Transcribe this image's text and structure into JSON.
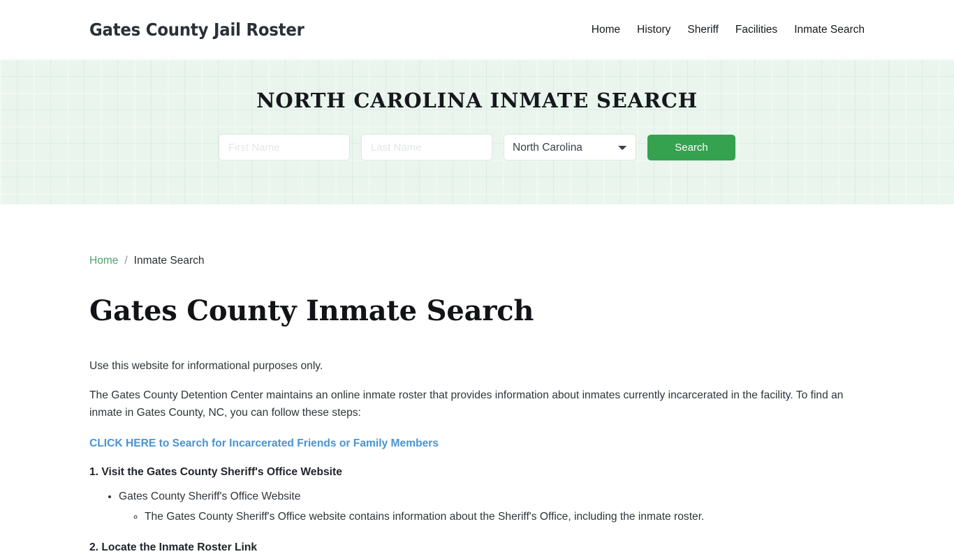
{
  "header": {
    "brand": "Gates County Jail Roster",
    "nav": [
      {
        "label": "Home"
      },
      {
        "label": "History"
      },
      {
        "label": "Sheriff"
      },
      {
        "label": "Facilities"
      },
      {
        "label": "Inmate Search"
      }
    ]
  },
  "hero": {
    "title": "NORTH CAROLINA INMATE SEARCH",
    "background_color": "#e9f5ed",
    "form": {
      "first_name_placeholder": "First Name",
      "first_name_value": "",
      "last_name_placeholder": "Last Name",
      "last_name_value": "",
      "state_selected": "North Carolina",
      "state_options": [
        "North Carolina"
      ],
      "submit_label": "Search",
      "submit_color": "#34a24f",
      "dropdown_icon": "chevron-down-icon"
    }
  },
  "breadcrumb": {
    "home_label": "Home",
    "separator": "/",
    "current_label": "Inmate Search",
    "link_color": "#4ca36d"
  },
  "main": {
    "page_title": "Gates County Inmate Search",
    "paragraphs": [
      "Use this website for informational purposes only.",
      "The Gates County Detention Center maintains an online inmate roster that provides information about inmates currently incarcerated in the facility. To find an inmate in Gates County, NC, you can follow these steps:"
    ],
    "cta_link": {
      "label": "CLICK HERE to Search for Incarcerated Friends or Family Members",
      "color": "#4a93d1"
    },
    "steps": [
      {
        "heading": "1. Visit the Gates County Sheriff's Office Website",
        "items": [
          {
            "label": "Gates County Sheriff's Office Website",
            "subitems": [
              "The Gates County Sheriff's Office website contains information about the Sheriff's Office, including the inmate roster."
            ]
          }
        ]
      },
      {
        "heading": "2. Locate the Inmate Roster Link",
        "items": []
      }
    ]
  }
}
